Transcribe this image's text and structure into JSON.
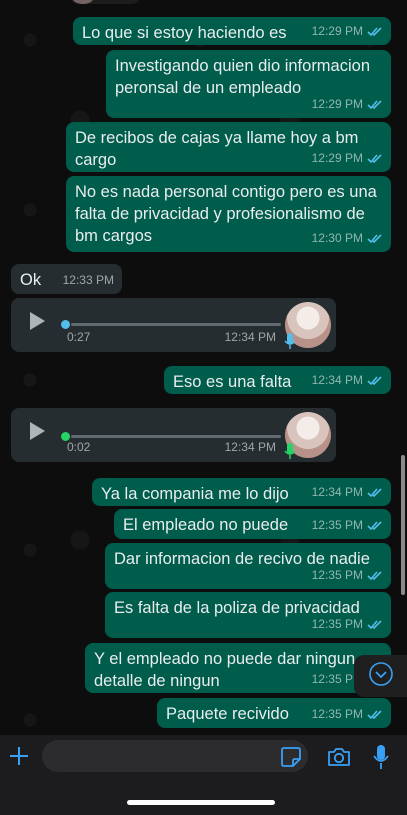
{
  "colors": {
    "outgoing_bubble": "#005c4b",
    "incoming_bubble": "#262d31",
    "read_ticks": "#53bdeb",
    "voice_unplayed_dot": "#53bdeb",
    "voice_played_dot": "#25d366",
    "accent_icons": "#3aa0f5"
  },
  "messages": [
    {
      "text": "Lo que si estoy haciendo es",
      "time": "12:29 PM",
      "direction": "outgoing",
      "status": "read"
    },
    {
      "text": "Investigando quien dio informacion peronsal de un empleado",
      "time": "12:29 PM",
      "direction": "outgoing",
      "status": "read"
    },
    {
      "text": "De recibos de cajas ya llame hoy a bm cargo",
      "time": "12:29 PM",
      "direction": "outgoing",
      "status": "read"
    },
    {
      "text": "No es nada personal contigo pero es una falta de privacidad y profesionalismo de bm cargos",
      "time": "12:30 PM",
      "direction": "outgoing",
      "status": "read"
    },
    {
      "text": "Ok",
      "time": "12:33 PM",
      "direction": "incoming"
    },
    {
      "type": "voice",
      "duration": "0:27",
      "time": "12:34 PM",
      "direction": "incoming",
      "played": false,
      "progress": 0.0
    },
    {
      "text": "Eso es una falta",
      "time": "12:34 PM",
      "direction": "outgoing",
      "status": "read"
    },
    {
      "type": "voice",
      "duration": "0:02",
      "time": "12:34 PM",
      "direction": "incoming",
      "played": true,
      "progress": 0.0
    },
    {
      "text": "Ya la compania me lo dijo",
      "time": "12:34 PM",
      "direction": "outgoing",
      "status": "read"
    },
    {
      "text": "El empleado no puede",
      "time": "12:35 PM",
      "direction": "outgoing",
      "status": "read"
    },
    {
      "text": "Dar informacion de recivo de nadie",
      "time": "12:35 PM",
      "direction": "outgoing",
      "status": "read"
    },
    {
      "text": "Es falta de la poliza de privacidad",
      "time": "12:35 PM",
      "direction": "outgoing",
      "status": "read"
    },
    {
      "text": "Y el empleado no puede dar ningun detalle de ningun",
      "time": "12:35 PM",
      "direction": "outgoing",
      "status": "read"
    },
    {
      "text": "Paquete recivido",
      "time": "12:35 PM",
      "direction": "outgoing",
      "status": "read"
    }
  ],
  "composer": {
    "value": "",
    "icons": [
      "plus-icon",
      "sticker-icon",
      "camera-icon",
      "microphone-icon"
    ]
  },
  "scroll_down_icon": "chevron-down-icon"
}
